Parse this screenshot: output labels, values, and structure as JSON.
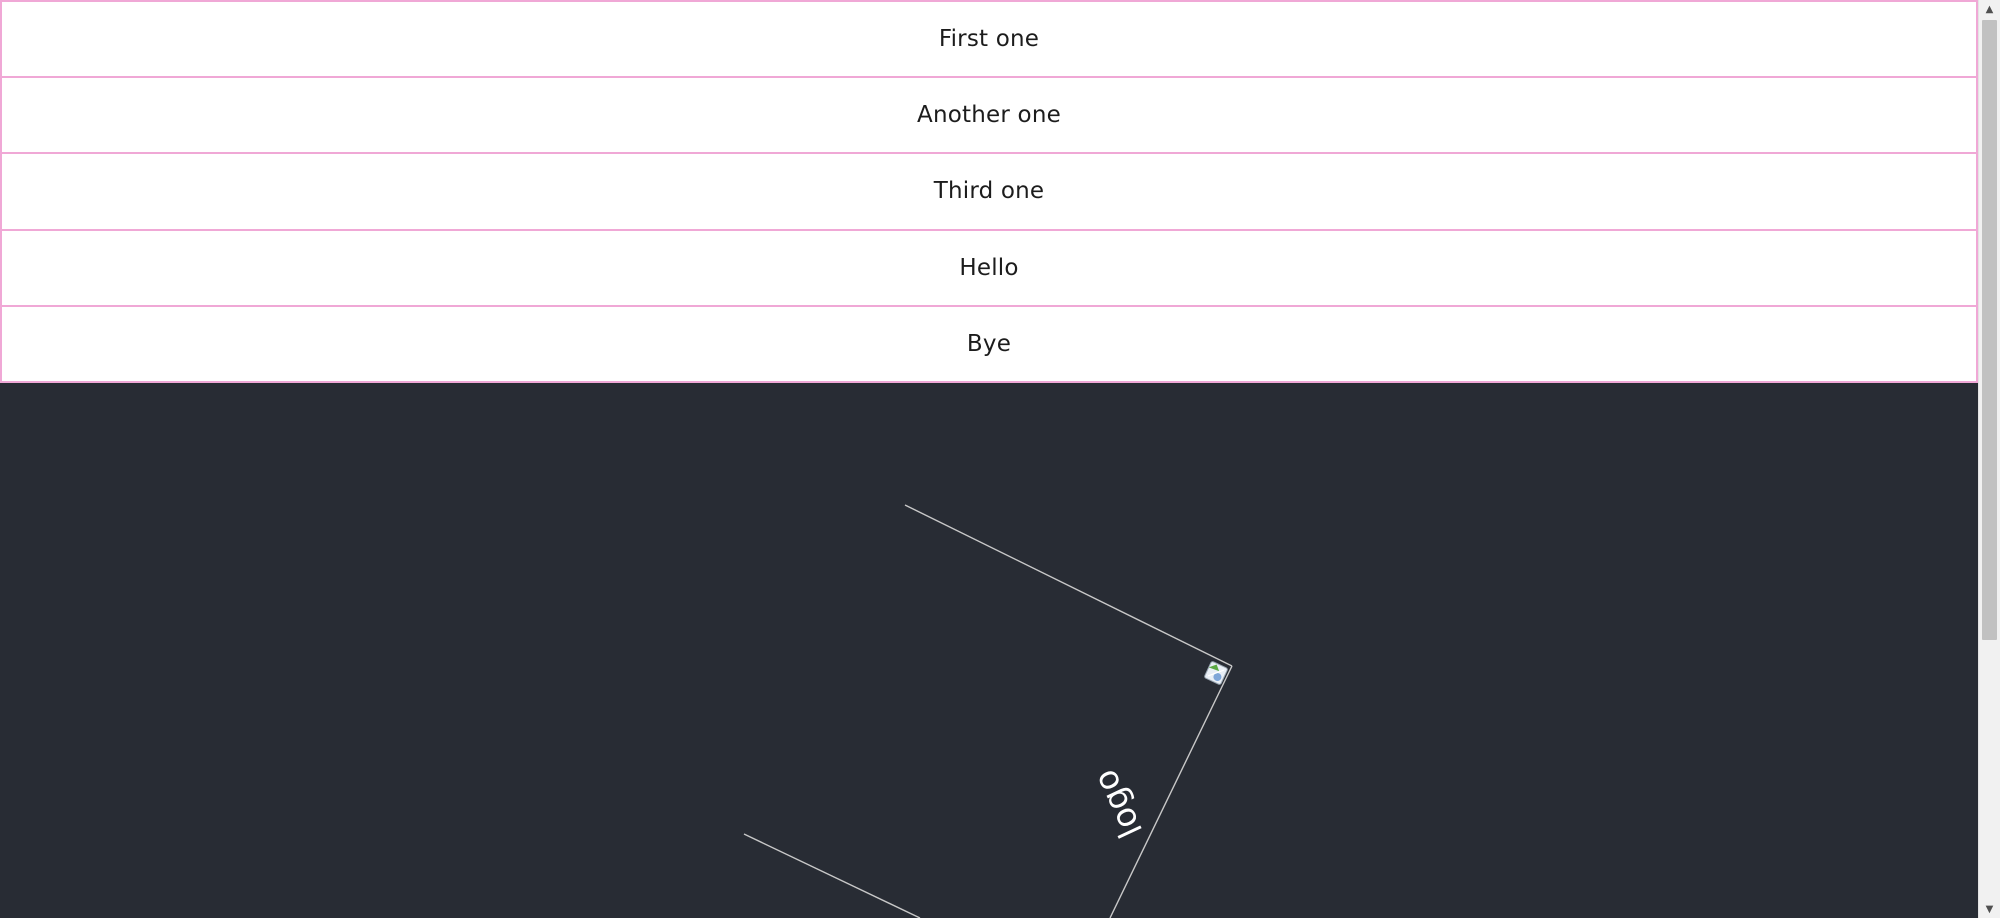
{
  "list": {
    "items": [
      {
        "label": "First one"
      },
      {
        "label": "Another one"
      },
      {
        "label": "Third one"
      },
      {
        "label": "Hello"
      },
      {
        "label": "Bye"
      }
    ]
  },
  "stage": {
    "caption": "logo",
    "background_color": "#282c34",
    "line_color": "#c8c8c8",
    "item_border_color": "#f0a8d6"
  },
  "scrollbar": {
    "up_icon": "▲",
    "down_icon": "▼"
  }
}
